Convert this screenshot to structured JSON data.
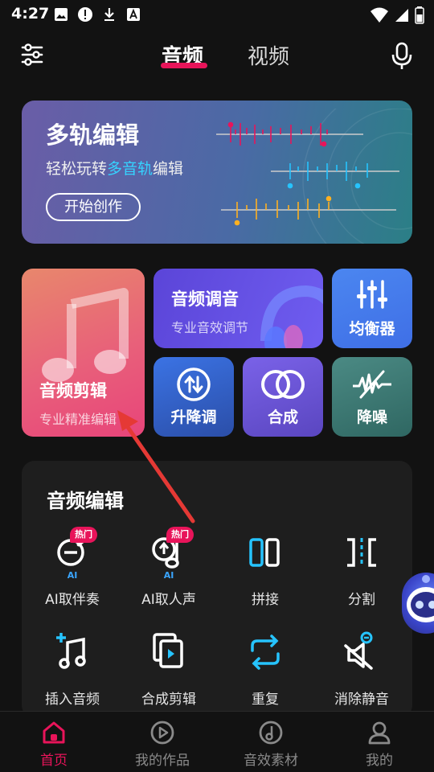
{
  "status": {
    "time": "4:27"
  },
  "header": {
    "tabs": [
      {
        "label": "音频",
        "active": true
      },
      {
        "label": "视频",
        "active": false
      }
    ]
  },
  "banner": {
    "title": "多轨编辑",
    "subtitle_before": "轻松玩转",
    "subtitle_highlight": "多音轨",
    "subtitle_after": "编辑",
    "button": "开始创作"
  },
  "cards": {
    "audio_edit": {
      "title": "音频剪辑",
      "subtitle": "专业精准编辑"
    },
    "audio_tune": {
      "title": "音频调音",
      "subtitle": "专业音效调节"
    },
    "equalizer": {
      "label": "均衡器"
    },
    "pitch": {
      "label": "升降调"
    },
    "mix": {
      "label": "合成"
    },
    "denoise": {
      "label": "降噪"
    }
  },
  "section": {
    "title": "音频编辑",
    "tools": [
      {
        "label": "AI取伴奏",
        "badge": "热门",
        "tag": "AI",
        "icon": "mic-minus-icon"
      },
      {
        "label": "AI取人声",
        "badge": "热门",
        "tag": "AI",
        "icon": "voice-extract-icon"
      },
      {
        "label": "拼接",
        "icon": "splice-icon"
      },
      {
        "label": "分割",
        "icon": "split-icon"
      },
      {
        "label": "插入音频",
        "icon": "insert-audio-icon"
      },
      {
        "label": "合成剪辑",
        "icon": "merge-clip-icon"
      },
      {
        "label": "重复",
        "icon": "repeat-icon"
      },
      {
        "label": "消除静音",
        "icon": "remove-silence-icon"
      }
    ]
  },
  "bottom_nav": [
    {
      "label": "首页",
      "active": true
    },
    {
      "label": "我的作品",
      "active": false
    },
    {
      "label": "音效素材",
      "active": false
    },
    {
      "label": "我的",
      "active": false
    }
  ],
  "colors": {
    "accent": "#e8145a",
    "highlight": "#35d3ff"
  }
}
